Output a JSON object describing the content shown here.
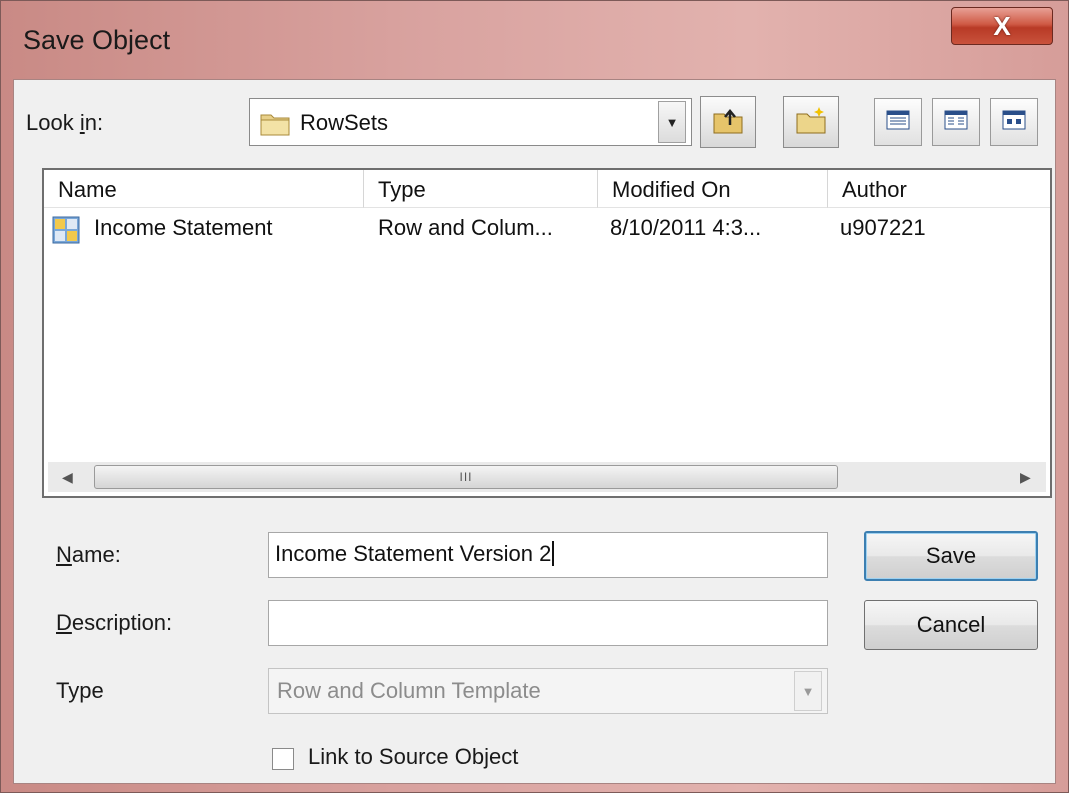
{
  "window": {
    "title": "Save Object",
    "close_glyph": "X"
  },
  "look_in": {
    "label_prefix": "Look ",
    "label_underlined": "i",
    "label_suffix": "n:",
    "value": "RowSets",
    "icon": "folder-icon"
  },
  "toolbar": {
    "up_folder_icon": "up-one-level-icon",
    "new_folder_icon": "new-folder-icon",
    "view_icons": [
      "list-view-icon",
      "details-view-icon",
      "large-icons-view-icon"
    ]
  },
  "file_list": {
    "columns": [
      "Name",
      "Type",
      "Modified On",
      "Author"
    ],
    "rows": [
      {
        "icon": "rowset-template-icon",
        "name": "Income Statement",
        "type": "Row and Colum...",
        "modified_on": "8/10/2011 4:3...",
        "author": "u907221"
      }
    ],
    "scrollbar_grip": "III"
  },
  "form": {
    "name_label_underlined": "N",
    "name_label_rest": "ame:",
    "name_value": "Income Statement Version 2",
    "description_label_underlined": "D",
    "description_label_rest": "escription:",
    "description_value": "",
    "type_label": "Type",
    "type_value": "Row and Column Template",
    "link_checkbox_label": "Link to Source Object",
    "link_checked": false
  },
  "buttons": {
    "save": "Save",
    "cancel": "Cancel"
  }
}
